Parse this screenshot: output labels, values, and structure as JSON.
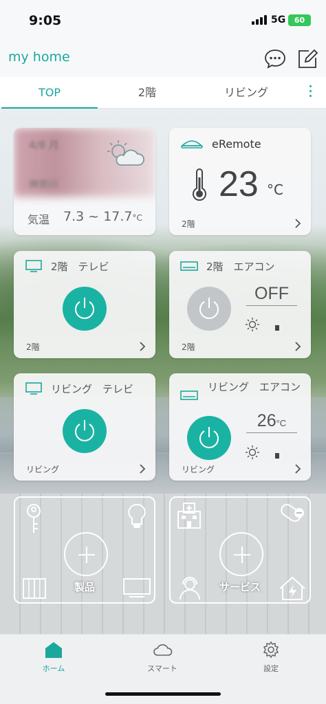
{
  "status_bar": {
    "time": "9:05",
    "network": "5G",
    "battery": "60"
  },
  "header": {
    "title": "my home"
  },
  "tabs": [
    {
      "label": "TOP"
    },
    {
      "label": "2階"
    },
    {
      "label": "リビング"
    }
  ],
  "weather_card": {
    "date": "4/8 月",
    "location": "神奈川",
    "temp_label": "気温",
    "temp_range": "7.3 ~ 17.7",
    "temp_unit": "°C"
  },
  "eremote_card": {
    "name": "eRemote",
    "temperature": "23",
    "temp_unit": "°C",
    "room": "2階"
  },
  "devices": {
    "tv_2f": {
      "name": "2階　テレビ",
      "room": "2階"
    },
    "ac_2f": {
      "name": "2階　エアコン",
      "state": "OFF",
      "room": "2階"
    },
    "tv_living": {
      "name": "リビング　テレビ",
      "room": "リビング"
    },
    "ac_living": {
      "name": "リビング　エアコン",
      "setpoint": "26",
      "unit": "°C",
      "room": "リビング"
    }
  },
  "add_cards": {
    "products": {
      "label": "製品"
    },
    "services": {
      "label": "サービス"
    }
  },
  "bottom_nav": [
    {
      "label": "ホーム",
      "icon": "home-icon"
    },
    {
      "label": "スマート",
      "icon": "cloud-icon"
    },
    {
      "label": "設定",
      "icon": "gear-icon"
    }
  ],
  "colors": {
    "accent": "#1aa89c",
    "power_on": "#1ab3a3",
    "power_off": "#c3c6c8"
  }
}
